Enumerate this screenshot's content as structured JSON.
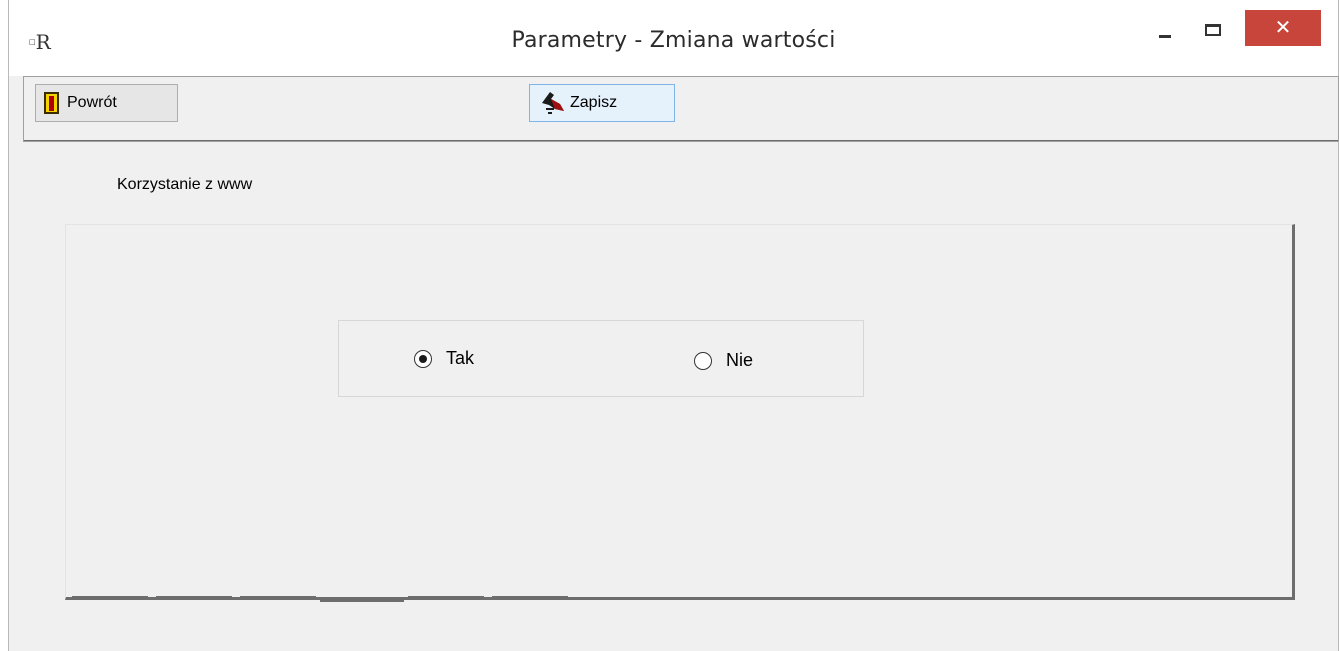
{
  "window": {
    "title": "Parametry - Zmiana wartości",
    "app_icon_text": "R",
    "close_symbol": "✕"
  },
  "toolbar": {
    "back_label": "Powrót",
    "save_label": "Zapisz"
  },
  "section": {
    "label": "Korzystanie z www"
  },
  "options": {
    "tak_label": "Tak",
    "nie_label": "Nie",
    "selected": "Tak"
  },
  "colors": {
    "close_button": "#c7453a",
    "window_bg": "#f0f0f0",
    "save_hover": "#e5f1fb"
  }
}
